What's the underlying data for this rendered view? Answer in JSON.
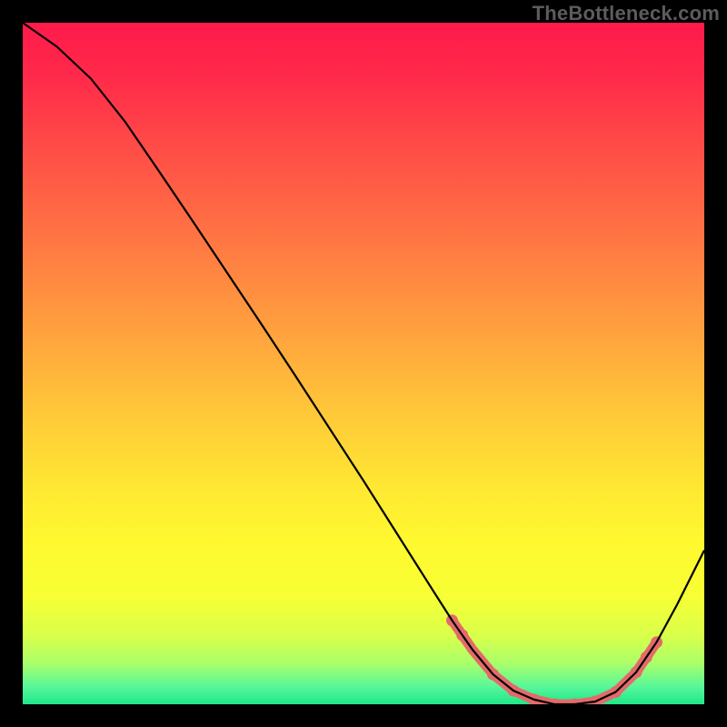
{
  "watermark": "TheBottleneck.com",
  "gradient": {
    "stops": [
      {
        "offset": 0.0,
        "color": "#ff1a4b"
      },
      {
        "offset": 0.08,
        "color": "#ff2a4a"
      },
      {
        "offset": 0.18,
        "color": "#ff4b47"
      },
      {
        "offset": 0.28,
        "color": "#ff6a44"
      },
      {
        "offset": 0.38,
        "color": "#ff8a41"
      },
      {
        "offset": 0.48,
        "color": "#ffaa3d"
      },
      {
        "offset": 0.58,
        "color": "#ffca38"
      },
      {
        "offset": 0.68,
        "color": "#ffe733"
      },
      {
        "offset": 0.76,
        "color": "#fff82f"
      },
      {
        "offset": 0.84,
        "color": "#f8ff34"
      },
      {
        "offset": 0.9,
        "color": "#d8ff4a"
      },
      {
        "offset": 0.94,
        "color": "#aaff6a"
      },
      {
        "offset": 0.975,
        "color": "#55f79a"
      },
      {
        "offset": 1.0,
        "color": "#1fe789"
      }
    ]
  },
  "chart_data": {
    "type": "line",
    "x": [
      0.0,
      0.05,
      0.1,
      0.15,
      0.2,
      0.25,
      0.3,
      0.35,
      0.4,
      0.45,
      0.5,
      0.55,
      0.6,
      0.63,
      0.66,
      0.69,
      0.72,
      0.75,
      0.78,
      0.81,
      0.84,
      0.87,
      0.9,
      0.93,
      0.96,
      1.0
    ],
    "values": [
      1.0,
      0.965,
      0.918,
      0.855,
      0.782,
      0.708,
      0.633,
      0.558,
      0.482,
      0.405,
      0.328,
      0.249,
      0.17,
      0.123,
      0.08,
      0.044,
      0.02,
      0.007,
      0.0,
      0.0,
      0.004,
      0.018,
      0.047,
      0.091,
      0.146,
      0.226
    ],
    "title": "",
    "xlabel": "",
    "ylabel": "",
    "xlim": [
      0,
      1
    ],
    "ylim": [
      0,
      1
    ],
    "highlight_band": {
      "start_x": 0.63,
      "end_x": 0.93,
      "color": "#e46a6a"
    }
  }
}
